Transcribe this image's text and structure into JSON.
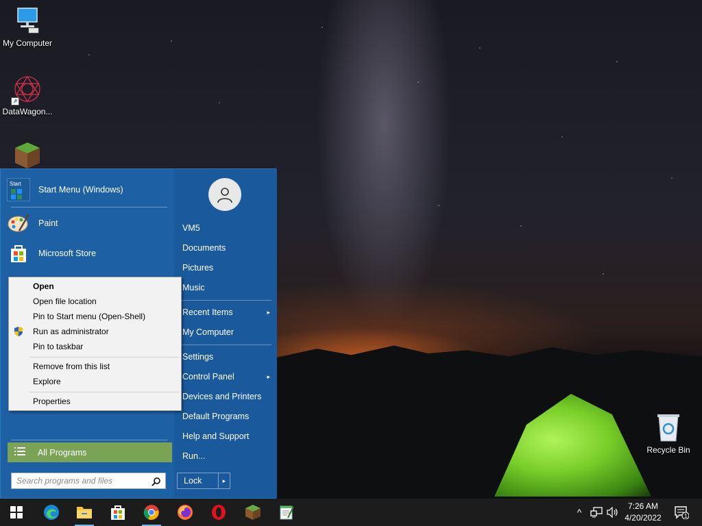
{
  "desktop": {
    "icons": [
      {
        "label": "My Computer"
      },
      {
        "label": "DataWagon..."
      },
      {
        "label": ""
      },
      {
        "label": "Recycle Bin"
      }
    ]
  },
  "start_menu": {
    "pinned": [
      {
        "label": "Start Menu (Windows)",
        "icon": "start-menu-app-icon"
      },
      {
        "label": "Paint",
        "icon": "paint-icon"
      },
      {
        "label": "Microsoft Store",
        "icon": "store-icon"
      }
    ],
    "all_programs_label": "All Programs",
    "search_placeholder": "Search programs and files",
    "right_items": [
      {
        "label": "VM5"
      },
      {
        "label": "Documents"
      },
      {
        "label": "Pictures"
      },
      {
        "label": "Music"
      },
      {
        "label": "Recent Items",
        "submenu": "▸"
      },
      {
        "label": "My Computer"
      },
      {
        "label": "Settings"
      },
      {
        "label": "Control Panel",
        "submenu": "▸"
      },
      {
        "label": "Devices and Printers"
      },
      {
        "label": "Default Programs"
      },
      {
        "label": "Help and Support"
      },
      {
        "label": "Run..."
      }
    ],
    "lock_label": "Lock",
    "lock_chevron": "▸"
  },
  "context_menu": {
    "items": [
      {
        "label": "Open"
      },
      {
        "label": "Open file location"
      },
      {
        "label": "Pin to Start menu (Open-Shell)"
      },
      {
        "label": "Run as administrator",
        "icon": "uac-shield-icon"
      },
      {
        "label": "Pin to taskbar"
      },
      {
        "label": "Remove from this list"
      },
      {
        "label": "Explore"
      },
      {
        "label": "Properties"
      }
    ]
  },
  "taskbar": {
    "apps": [
      {
        "name": "windows-start-icon"
      },
      {
        "name": "edge-icon"
      },
      {
        "name": "file-explorer-icon"
      },
      {
        "name": "store-icon"
      },
      {
        "name": "chrome-icon"
      },
      {
        "name": "firefox-icon"
      },
      {
        "name": "opera-icon"
      },
      {
        "name": "minecraft-icon"
      },
      {
        "name": "notepad-icon"
      }
    ],
    "tray": {
      "chevron": "^",
      "time": "7:26 AM",
      "date": "4/20/2022",
      "notification_count": "1"
    }
  },
  "colors": {
    "start_menu_bg": "#1e63a8",
    "all_programs_bg": "#7aa356",
    "taskbar_bg": "#1c1c1c",
    "accent": "#76b9ed"
  }
}
